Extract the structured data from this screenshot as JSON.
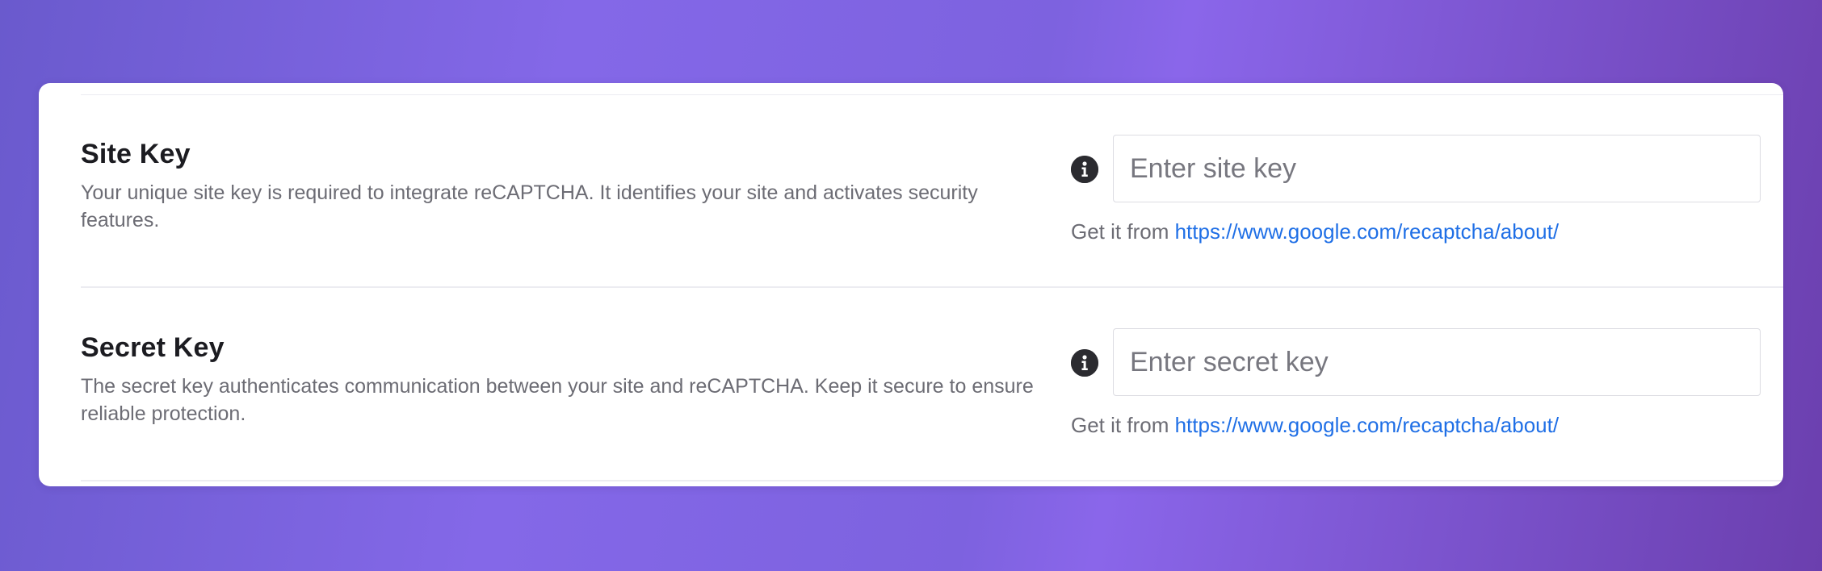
{
  "fields": {
    "site": {
      "title": "Site Key",
      "description": "Your unique site key is required to integrate reCAPTCHA. It identifies your site and activates security features.",
      "placeholder": "Enter site key",
      "value": "",
      "hint_prefix": "Get it from",
      "hint_link": "https://www.google.com/recaptcha/about/",
      "icon": "info-icon"
    },
    "secret": {
      "title": "Secret Key",
      "description": "The secret key authenticates communication between your site and reCAPTCHA. Keep it secure to ensure reliable protection.",
      "placeholder": "Enter secret key",
      "value": "",
      "hint_prefix": "Get it from",
      "hint_link": "https://www.google.com/recaptcha/about/",
      "icon": "info-icon"
    }
  },
  "colors": {
    "background_gradient": [
      "#6a5acd",
      "#8468e8",
      "#6b3fae"
    ],
    "card": "#ffffff",
    "title_text": "#1c1c21",
    "muted_text": "#6c6c74",
    "link": "#1f6fe6",
    "icon_fill": "#2b2b30"
  }
}
